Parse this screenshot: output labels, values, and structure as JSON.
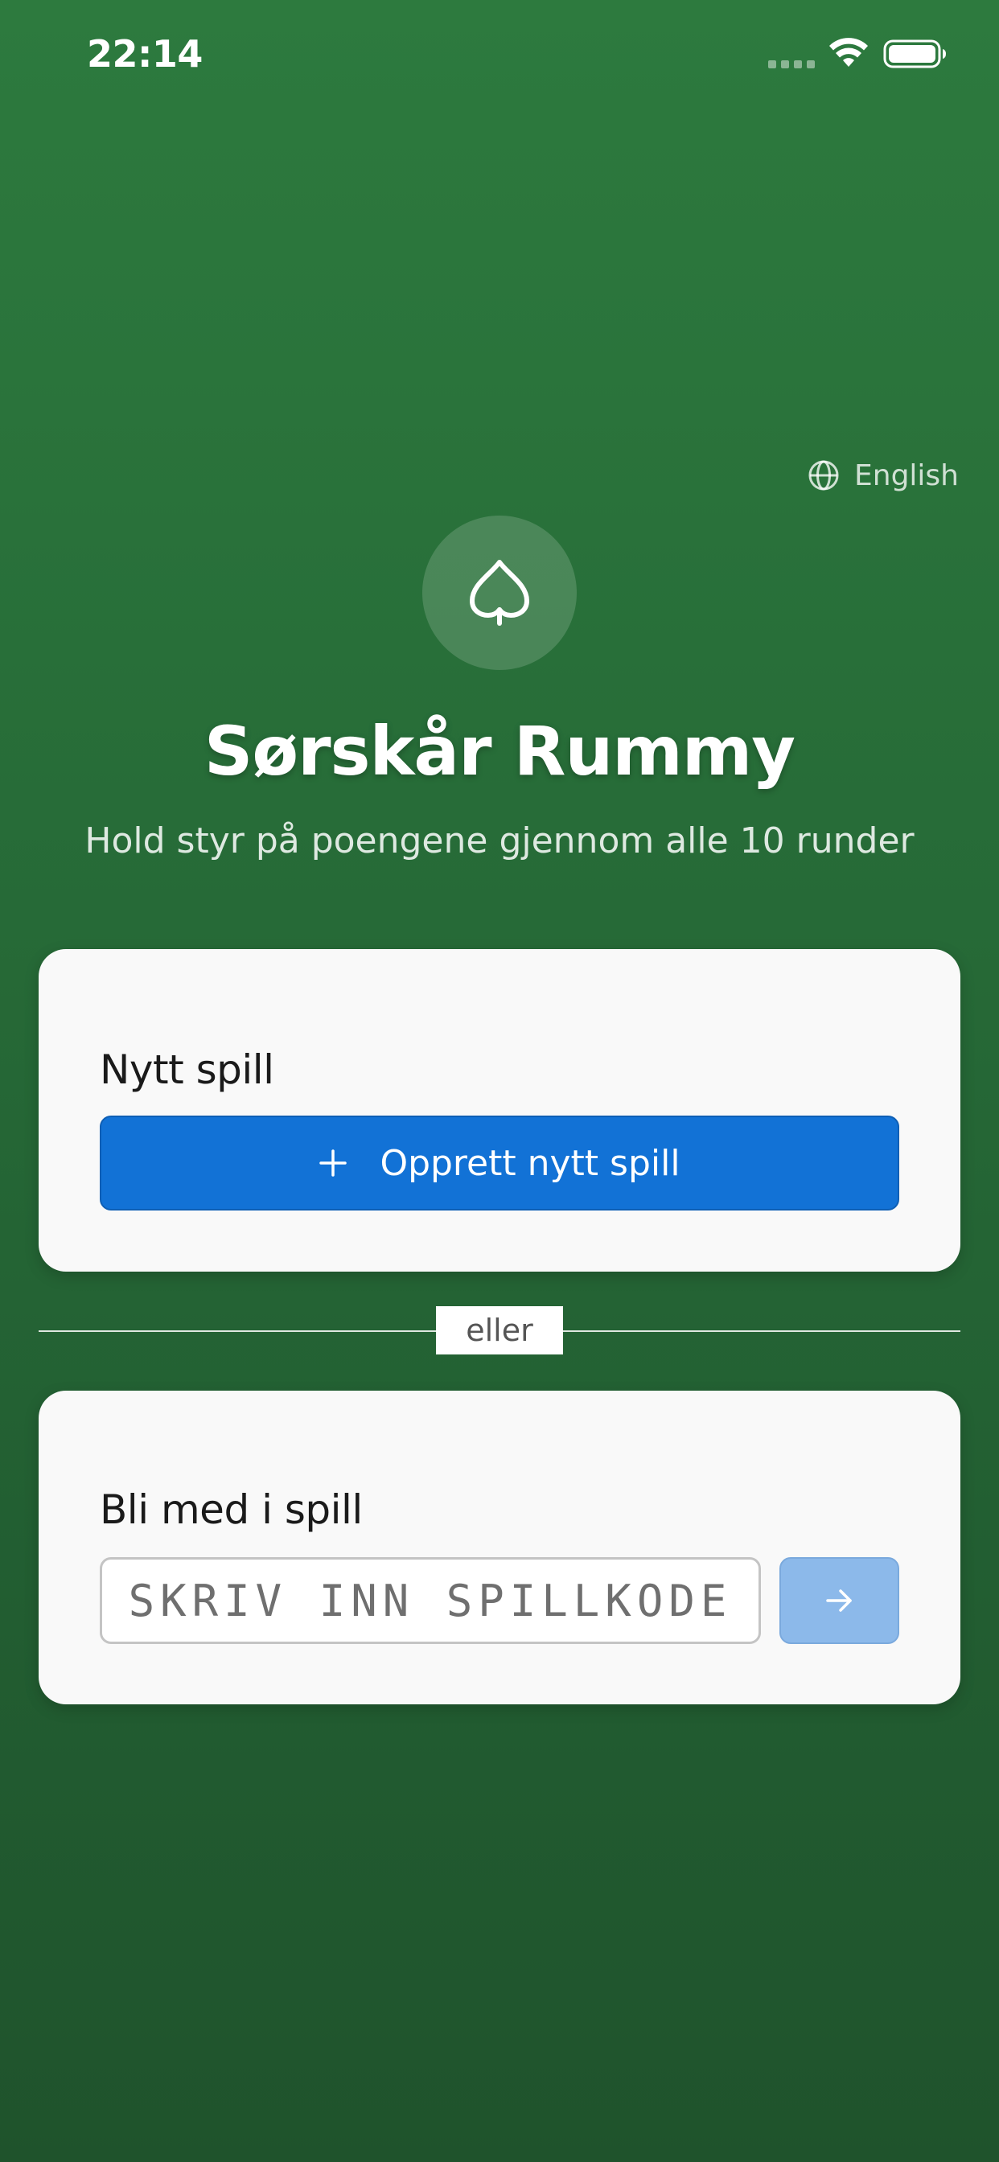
{
  "status_bar": {
    "time": "22:14",
    "signal_icon": "cellular-signal-icon",
    "wifi_icon": "wifi-icon",
    "battery_icon": "battery-icon"
  },
  "language": {
    "icon": "globe-icon",
    "label": "English"
  },
  "header": {
    "logo_icon": "spade-icon",
    "title": "Sørskår Rummy",
    "subtitle": "Hold styr på poengene gjennom alle 10 runder"
  },
  "new_game": {
    "title": "Nytt spill",
    "button_icon": "plus-icon",
    "button_label": "Opprett nytt spill"
  },
  "divider": {
    "label": "eller"
  },
  "join_game": {
    "title": "Bli med i spill",
    "input_value": "",
    "input_placeholder": "SKRIV INN SPILLKODE",
    "submit_icon": "arrow-right-icon"
  },
  "colors": {
    "background_top": "#2d7a3e",
    "background_bottom": "#1f532c",
    "primary_button": "#1272d6",
    "disabled_button": "#8cb9ea",
    "card_background": "#f9f9f9"
  }
}
